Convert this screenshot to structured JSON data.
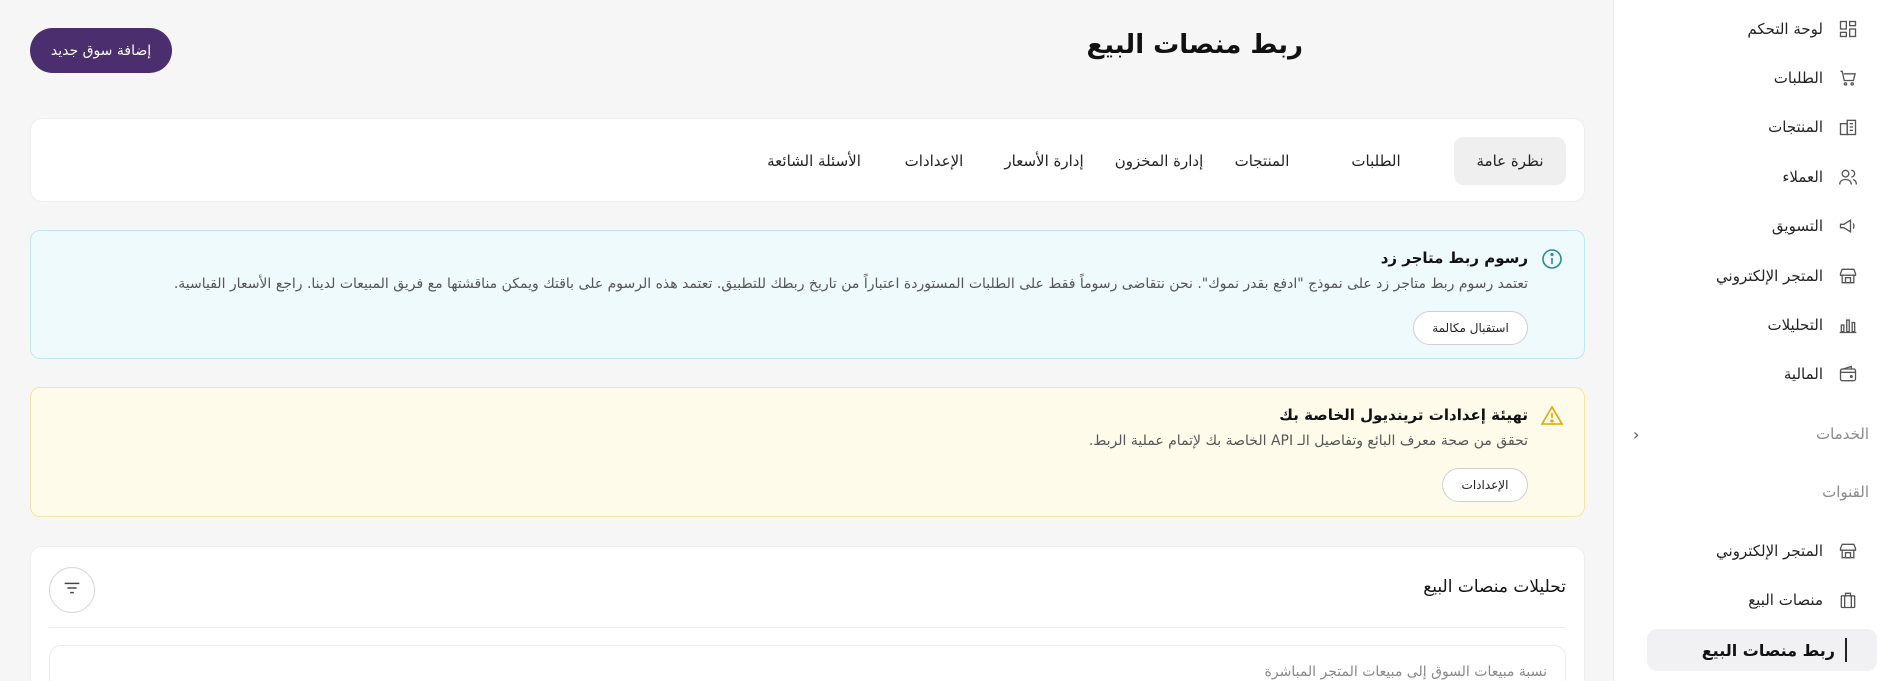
{
  "sidebar": {
    "items": [
      {
        "label": "لوحة التحكم",
        "icon": "dashboard-icon"
      },
      {
        "label": "الطلبات",
        "icon": "cart-icon"
      },
      {
        "label": "المنتجات",
        "icon": "products-icon"
      },
      {
        "label": "العملاء",
        "icon": "users-icon"
      },
      {
        "label": "التسويق",
        "icon": "megaphone-icon"
      },
      {
        "label": "المتجر الإلكتروني",
        "icon": "store-icon"
      },
      {
        "label": "التحليلات",
        "icon": "bar-chart-icon"
      },
      {
        "label": "المالية",
        "icon": "wallet-icon"
      }
    ],
    "services_label": "الخدمات",
    "channels_label": "القنوات",
    "channel_items": [
      {
        "label": "المتجر الإلكتروني",
        "icon": "store-icon"
      },
      {
        "label": "منصات البيع",
        "icon": "briefcase-icon"
      }
    ],
    "active_item": "ربط منصات البيع"
  },
  "header": {
    "title": "ربط منصات البيع",
    "add_button": "إضافة سوق جديد"
  },
  "tabs": [
    {
      "label": "نظرة عامة",
      "active": true
    },
    {
      "label": "الطلبات"
    },
    {
      "label": "المنتجات"
    },
    {
      "label": "إدارة المخزون"
    },
    {
      "label": "إدارة الأسعار"
    },
    {
      "label": "الإعدادات"
    },
    {
      "label": "الأسئلة الشائعة"
    }
  ],
  "info_alert": {
    "title": "رسوم ربط متاجر زد",
    "text": "تعتمد رسوم ربط متاجر زد على نموذج \"ادفع بقدر نموك\". نحن نتقاضى رسوماً فقط على الطلبات المستوردة اعتباراً من تاريخ ربطك للتطبيق. تعتمد هذه الرسوم على باقتك ويمكن مناقشتها مع فريق المبيعات لدينا. راجع الأسعار القياسية.",
    "button": "استقبال مكالمة"
  },
  "warn_alert": {
    "title": "تهيئة إعدادات ترينديول الخاصة بك",
    "text": "تحقق من صحة معرف البائع وتفاصيل الـ API الخاصة بك لإتمام عملية الربط.",
    "button": "الإعدادات"
  },
  "analytics": {
    "title": "تحليلات منصات البيع",
    "subtitle": "نسبة مبيعات السوق إلى مبيعات المتجر المباشرة"
  },
  "colors": {
    "primary": "#4a2e6e",
    "info_bg": "#eefafb",
    "warn_bg": "#fefbeb",
    "warn_icon": "#e0a800",
    "info_icon": "#2a8a9a"
  }
}
